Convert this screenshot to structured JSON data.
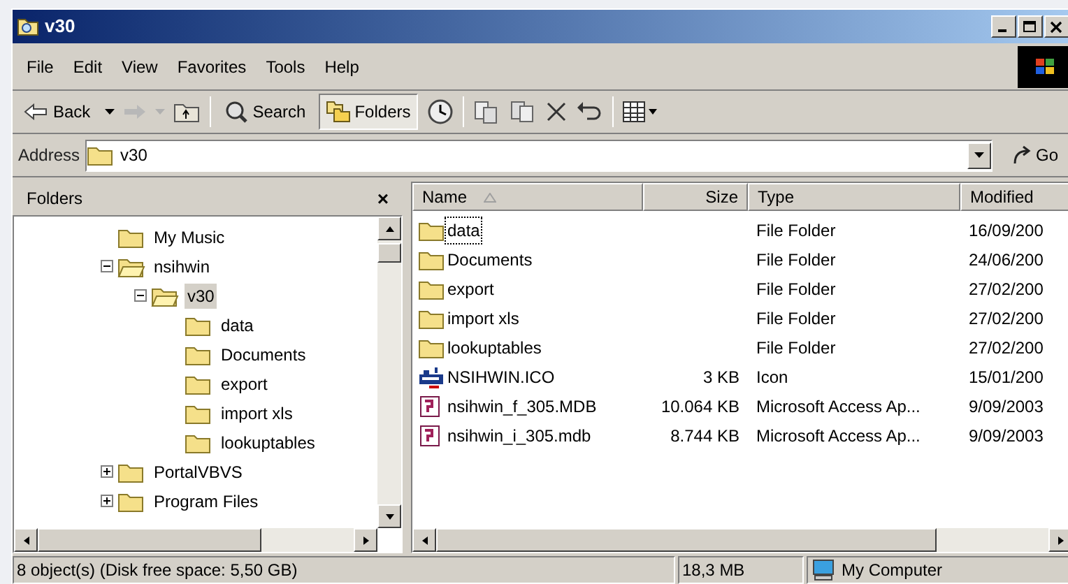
{
  "window": {
    "title": "v30"
  },
  "menu": [
    "File",
    "Edit",
    "View",
    "Favorites",
    "Tools",
    "Help"
  ],
  "toolbar": {
    "back": "Back",
    "search": "Search",
    "folders": {
      "label": "Folders",
      "selected": true
    }
  },
  "address": {
    "label": "Address",
    "value": "v30",
    "go": "Go"
  },
  "folders_pane": {
    "title": "Folders",
    "close": "×",
    "tree": [
      {
        "label": "My Music",
        "expandable": false,
        "expanded": false,
        "selected": false
      },
      {
        "label": "nsihwin",
        "expandable": true,
        "expanded": true,
        "selected": false,
        "children": [
          {
            "label": "v30",
            "expandable": true,
            "expanded": true,
            "selected": true,
            "children": [
              {
                "label": "data",
                "expandable": false,
                "expanded": false,
                "selected": false
              },
              {
                "label": "Documents",
                "expandable": false,
                "expanded": false,
                "selected": false
              },
              {
                "label": "export",
                "expandable": false,
                "expanded": false,
                "selected": false
              },
              {
                "label": "import xls",
                "expandable": false,
                "expanded": false,
                "selected": false
              },
              {
                "label": "lookuptables",
                "expandable": false,
                "expanded": false,
                "selected": false
              }
            ]
          }
        ]
      },
      {
        "label": "PortalVBVS",
        "expandable": true,
        "expanded": false,
        "selected": false
      },
      {
        "label": "Program Files",
        "expandable": true,
        "expanded": false,
        "selected": false
      }
    ]
  },
  "files": {
    "columns": [
      "Name",
      "Size",
      "Type",
      "Modified"
    ],
    "rows": [
      {
        "kind": "folder",
        "name": "data",
        "size": "",
        "type": "File Folder",
        "modified": "16/09/200",
        "focused": true
      },
      {
        "kind": "folder",
        "name": "Documents",
        "type": "File Folder",
        "modified": "24/06/200",
        "focused": false
      },
      {
        "kind": "folder",
        "name": "export",
        "type": "File Folder",
        "modified": "27/02/200",
        "focused": false
      },
      {
        "kind": "folder",
        "name": "import xls",
        "type": "File Folder",
        "modified": "27/02/200",
        "focused": false
      },
      {
        "kind": "folder",
        "name": "lookuptables",
        "type": "File Folder",
        "modified": "27/02/200",
        "focused": false
      },
      {
        "kind": "icon",
        "name": "NSIHWIN.ICO",
        "size": "3 KB",
        "type": "Icon",
        "modified": "15/01/200",
        "focused": false
      },
      {
        "kind": "access",
        "name": "nsihwin_f_305.MDB",
        "size": "10.064 KB",
        "type": "Microsoft Access Ap...",
        "modified": "9/09/2003",
        "focused": false
      },
      {
        "kind": "access",
        "name": "nsihwin_i_305.mdb",
        "size": "8.744 KB",
        "type": "Microsoft Access Ap...",
        "modified": "9/09/2003",
        "focused": false
      }
    ]
  },
  "status_bar": {
    "objects": "8 object(s) (Disk free space: 5,50 GB)",
    "size": "18,3 MB",
    "zone": "My Computer"
  }
}
